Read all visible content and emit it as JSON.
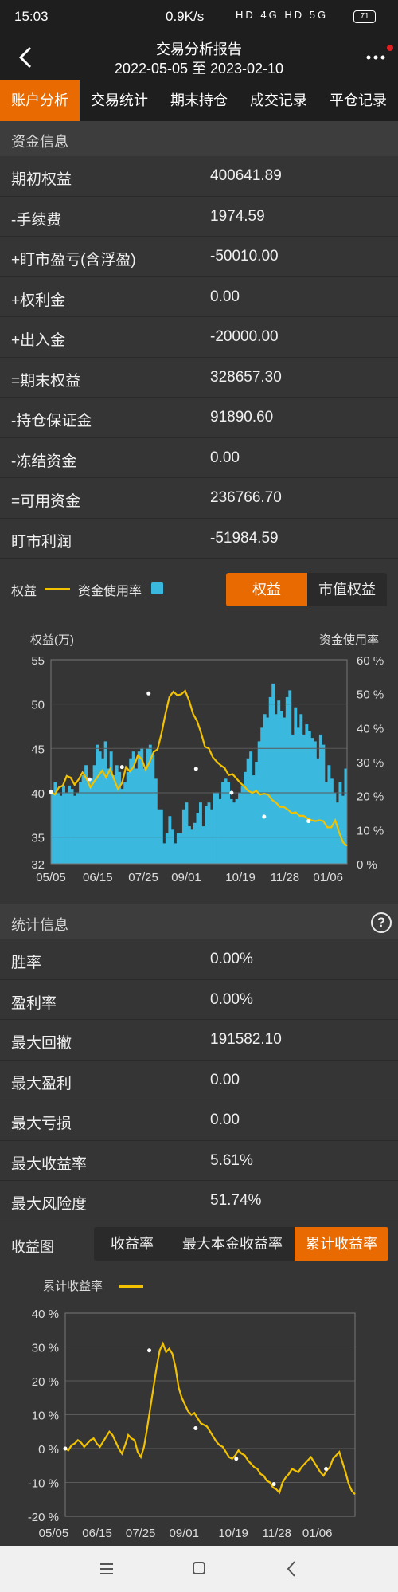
{
  "status": {
    "time": "15:03",
    "speed": "0.9K/s",
    "icons": "HD 4G HD 5G",
    "battery": "71"
  },
  "header": {
    "title": "交易分析报告",
    "date_range": "2022-05-05 至 2023-02-10",
    "more": "···"
  },
  "tabs": [
    {
      "label": "账户分析",
      "active": true
    },
    {
      "label": "交易统计",
      "active": false
    },
    {
      "label": "期末持仓",
      "active": false
    },
    {
      "label": "成交记录",
      "active": false
    },
    {
      "label": "平仓记录",
      "active": false
    }
  ],
  "funds": {
    "section_title": "资金信息",
    "rows": [
      {
        "label": "期初权益",
        "value": "400641.89"
      },
      {
        "label": "-手续费",
        "value": "1974.59"
      },
      {
        "label": "+盯市盈亏(含浮盈)",
        "value": "-50010.00"
      },
      {
        "label": "+权利金",
        "value": "0.00"
      },
      {
        "label": "+出入金",
        "value": "-20000.00"
      },
      {
        "label": "=期末权益",
        "value": "328657.30"
      },
      {
        "label": "-持仓保证金",
        "value": "91890.60"
      },
      {
        "label": "-冻结资金",
        "value": "0.00"
      },
      {
        "label": "=可用资金",
        "value": "236766.70"
      },
      {
        "label": "盯市利润",
        "value": "-51984.59"
      }
    ]
  },
  "chart1_controls": {
    "legend_equity": "权益",
    "legend_usage": "资金使用率",
    "toggle": [
      {
        "label": "权益",
        "active": true
      },
      {
        "label": "市值权益",
        "active": false
      }
    ]
  },
  "stats": {
    "section_title": "统计信息",
    "help": "?",
    "rows": [
      {
        "label": "胜率",
        "value": "0.00%"
      },
      {
        "label": "盈利率",
        "value": "0.00%"
      },
      {
        "label": "最大回撤",
        "value": "191582.10"
      },
      {
        "label": "最大盈利",
        "value": "0.00"
      },
      {
        "label": "最大亏损",
        "value": "0.00"
      },
      {
        "label": "最大收益率",
        "value": "5.61%"
      },
      {
        "label": "最大风险度",
        "value": "51.74%"
      }
    ]
  },
  "chart2_controls": {
    "label": "收益图",
    "toggle": [
      {
        "label": "收益率",
        "active": false
      },
      {
        "label": "最大本金收益率",
        "active": false
      },
      {
        "label": "累计收益率",
        "active": true
      }
    ]
  },
  "colors": {
    "accent": "#e96a00",
    "equity_line": "#f2c200",
    "usage_bar": "#3bb8de",
    "background": "#353535"
  },
  "chart_data": [
    {
      "type": "line+bar",
      "left_axis_title": "权益(万)",
      "right_axis_title": "资金使用率",
      "y_ticks": [
        "55",
        "50",
        "45",
        "40",
        "35",
        "32"
      ],
      "y_range": [
        32,
        55
      ],
      "y2_ticks": [
        "60 %",
        "50 %",
        "40 %",
        "30 %",
        "20 %",
        "10 %",
        "0 %"
      ],
      "y2_range": [
        0,
        60
      ],
      "x_ticks": [
        "05/05",
        "06/15",
        "07/25",
        "09/01",
        "10/19",
        "11/28",
        "01/06"
      ],
      "series": [
        {
          "name": "权益",
          "kind": "line",
          "values": [
            40.1,
            39.8,
            40.6,
            40.8,
            41.9,
            41.7,
            40.9,
            41.5,
            42.3,
            41.6,
            40.6,
            41.3,
            41.9,
            42.5,
            41.7,
            42.7,
            41.5,
            40.4,
            41.1,
            42.9,
            42.4,
            43.0,
            44.2,
            43.8,
            42.6,
            43.5,
            44.6,
            44.9,
            46.7,
            48.9,
            50.8,
            51.4,
            51.0,
            51.1,
            51.5,
            50.4,
            48.9,
            48.1,
            46.8,
            45.2,
            45.0,
            44.0,
            43.5,
            43.1,
            42.8,
            42.0,
            42.1,
            41.6,
            41.1,
            40.7,
            40.2,
            40.0,
            40.2,
            39.8,
            39.9,
            39.8,
            39.2,
            38.9,
            38.4,
            38.4,
            38.1,
            37.7,
            37.8,
            37.4,
            37.4,
            37.1,
            36.9,
            36.8,
            36.9,
            36.8,
            36.1,
            36.1,
            36.9,
            35.5,
            34.4,
            34.0
          ]
        },
        {
          "name": "资金使用率",
          "kind": "bar",
          "values": [
            21,
            24,
            21,
            20,
            23,
            21,
            23,
            22,
            20,
            21,
            24,
            26,
            29,
            24,
            25,
            29,
            35,
            33,
            31,
            36,
            28,
            33,
            26,
            29,
            27,
            22,
            24,
            27,
            31,
            33,
            28,
            33,
            34,
            28,
            34,
            35,
            32,
            25,
            16,
            16,
            6,
            9,
            14,
            10,
            6,
            9,
            9,
            16,
            18,
            11,
            10,
            12,
            15,
            18,
            11,
            17,
            18,
            16,
            21,
            21,
            19,
            24,
            25,
            24,
            19,
            18,
            19,
            21,
            23,
            27,
            31,
            33,
            26,
            30,
            36,
            40,
            44,
            43,
            49,
            53,
            44,
            48,
            45,
            43,
            49,
            51,
            38,
            46,
            40,
            44,
            38,
            41,
            39,
            37,
            36,
            31,
            38,
            35,
            24,
            29,
            25,
            21,
            18,
            24,
            20,
            28
          ]
        }
      ]
    },
    {
      "type": "line",
      "legend": "累计收益率",
      "y_ticks": [
        "40 %",
        "30 %",
        "20 %",
        "10 %",
        "0 %",
        "-10 %",
        "-20 %"
      ],
      "y_range": [
        -20,
        40
      ],
      "x_ticks": [
        "05/05",
        "06/15",
        "07/25",
        "09/01",
        "10/19",
        "11/28",
        "01/06"
      ],
      "series": [
        {
          "name": "累计收益率",
          "values": [
            0.0,
            -0.5,
            1.0,
            1.5,
            2.5,
            1.8,
            0.5,
            1.5,
            2.5,
            3.0,
            1.5,
            0.5,
            2.0,
            3.5,
            5.0,
            4.0,
            2.0,
            0.0,
            -1.5,
            1.0,
            4.0,
            3.0,
            2.5,
            -1.0,
            -2.5,
            0.5,
            6.0,
            12.0,
            18.0,
            24.0,
            29.0,
            31.0,
            28.5,
            29.5,
            28.0,
            24.0,
            18.0,
            15.0,
            13.0,
            11.0,
            10.0,
            10.5,
            9.0,
            7.5,
            7.0,
            6.5,
            5.0,
            3.5,
            2.0,
            1.0,
            0.5,
            -1.0,
            -2.5,
            -3.0,
            -2.0,
            -0.5,
            -1.5,
            -2.0,
            -3.5,
            -4.5,
            -5.5,
            -6.0,
            -7.5,
            -8.0,
            -9.5,
            -10.0,
            -11.5,
            -12.0,
            -13.0,
            -10.0,
            -8.5,
            -7.5,
            -6.0,
            -6.5,
            -7.0,
            -5.5,
            -4.5,
            -3.5,
            -2.5,
            -4.0,
            -5.5,
            -7.0,
            -8.0,
            -6.5,
            -5.5,
            -3.0,
            -2.0,
            -1.0,
            -4.0,
            -7.0,
            -10.5,
            -12.5,
            -13.5
          ]
        }
      ]
    }
  ],
  "nav": {
    "menu": "menu-icon",
    "home": "square-icon",
    "back": "back-triangle-icon"
  }
}
